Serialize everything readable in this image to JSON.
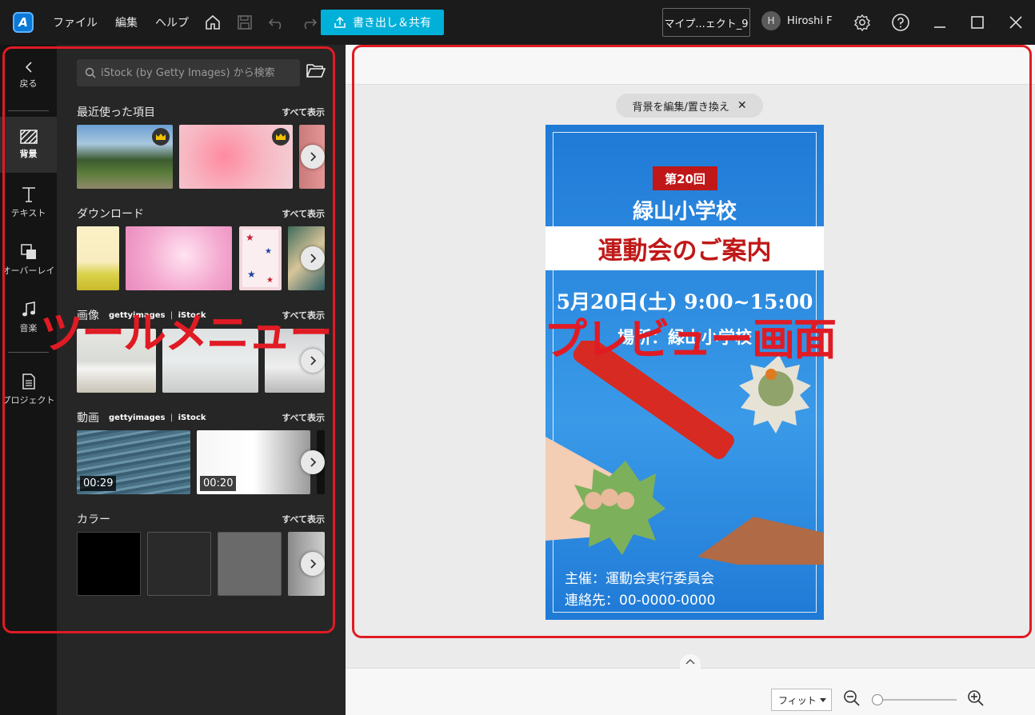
{
  "titlebar": {
    "menu": [
      "ファイル",
      "編集",
      "ヘルプ"
    ],
    "export_label": "書き出し＆共有",
    "project_name": "マイプ...ェクト_9",
    "user_initial": "H",
    "user_name": "Hiroshi F"
  },
  "rail": {
    "back": "戻る",
    "items": [
      "背景",
      "テキスト",
      "オーバーレイ",
      "音楽",
      "プロジェクト"
    ]
  },
  "panel": {
    "search_placeholder": "iStock (by Getty Images) から検索",
    "see_all": "すべて表示",
    "recent": "最近使った項目",
    "download": "ダウンロード",
    "images": "画像",
    "video": "動画",
    "color": "カラー",
    "brand_getty": "gettyimages",
    "brand_istock": "iStock",
    "durations": [
      "00:29",
      "00:20"
    ]
  },
  "preview": {
    "bg_chip": "背景を編集/置き換え",
    "zoom_fit": "フィット"
  },
  "poster": {
    "badge": "第20回",
    "school": "緑山小学校",
    "title": "運動会のご案内",
    "datetime": "5月20日(土) 9:00~15:00",
    "venue": "場所：緑山小学校",
    "organizer": "主催：運動会実行委員会",
    "contact": "連絡先：00-0000-0000"
  },
  "annotations": {
    "tool_menu": "ツールメニュー",
    "preview_screen": "プレビュー画面"
  },
  "colors": {
    "accent": "#00b0d8",
    "annotation": "#e01b24",
    "poster_blue": "#1f7ad6",
    "poster_red": "#c01818"
  }
}
